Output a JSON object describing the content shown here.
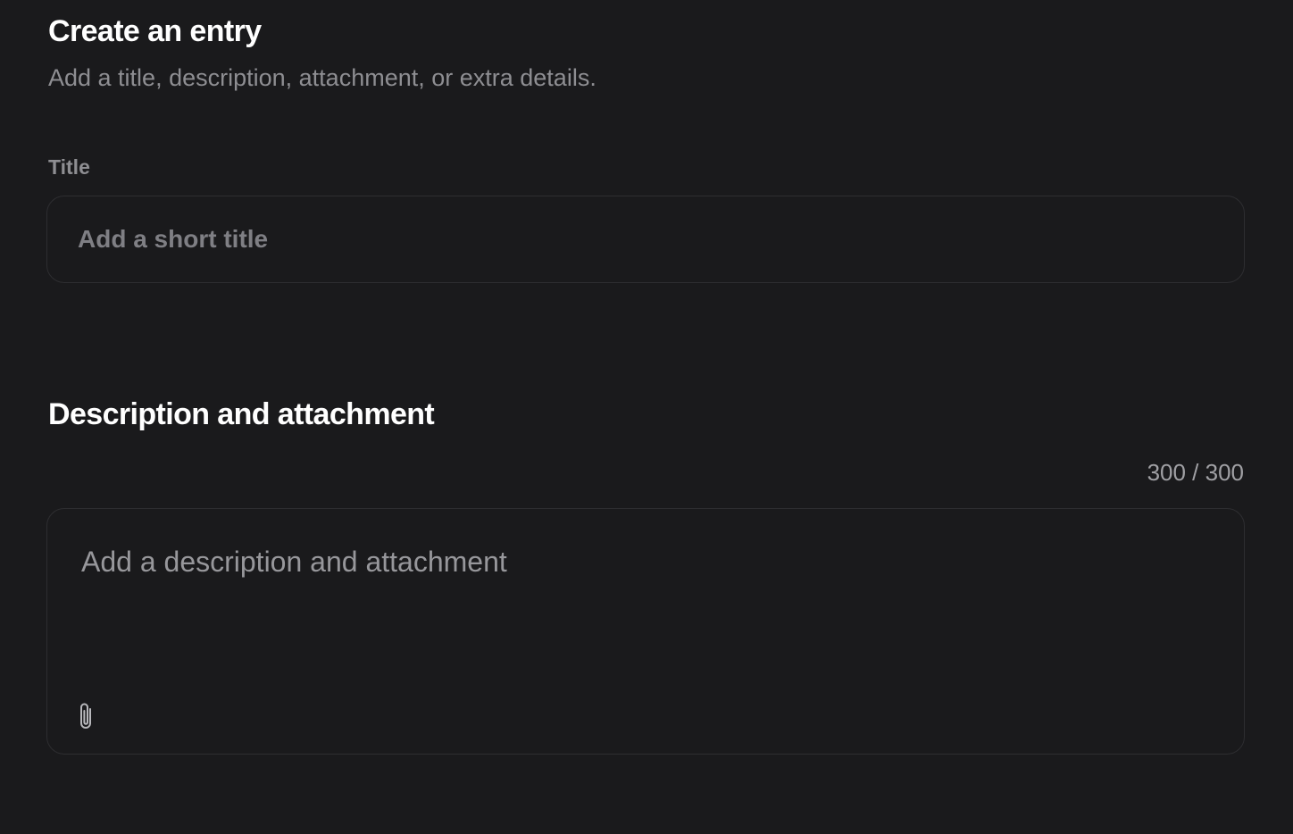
{
  "header": {
    "title": "Create an entry",
    "subtitle": "Add a title, description, attachment, or extra details."
  },
  "title_section": {
    "label": "Title",
    "input_value": "",
    "input_placeholder": "Add a short title"
  },
  "description_section": {
    "heading": "Description and attachment",
    "counter": "300 / 300",
    "textarea_value": "",
    "textarea_placeholder": "Add a description and attachment",
    "attach_icon": "paperclip-icon"
  },
  "colors": {
    "background": "#1a1a1c",
    "border": "#2e2e31",
    "heading": "#ffffff",
    "muted_text": "#8e8e92"
  }
}
